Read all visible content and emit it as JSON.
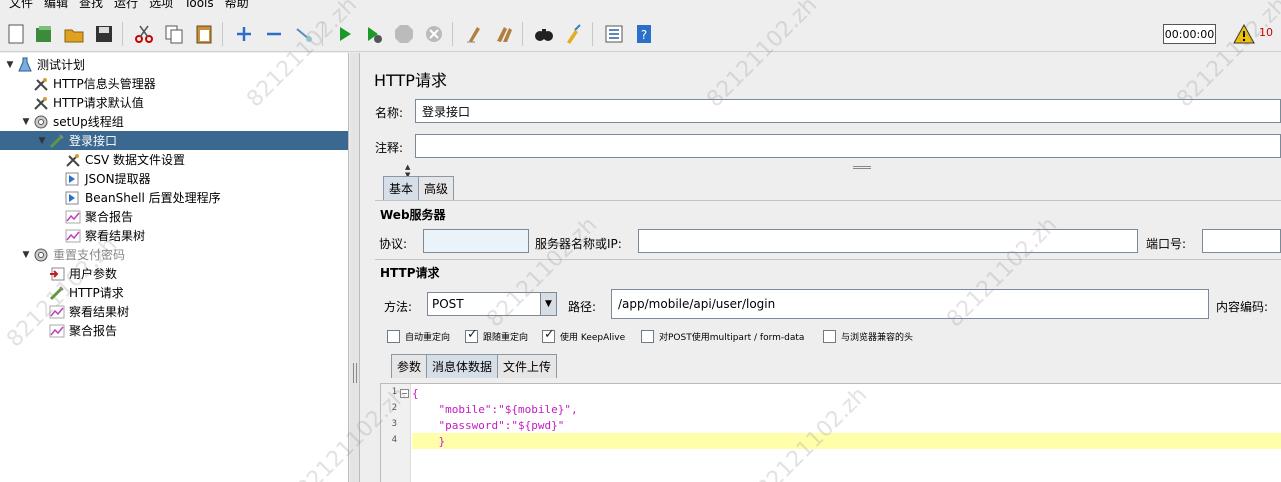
{
  "menu": [
    "文件",
    "编辑",
    "查找",
    "运行",
    "选项",
    "Tools",
    "帮助"
  ],
  "toolbar": {
    "timer": "00:00:00",
    "warning_count": "10",
    "icons": [
      "new-icon",
      "templates-icon",
      "open-icon",
      "save-icon",
      "cut-icon",
      "copy-icon",
      "paste-icon",
      "expand-icon",
      "collapse-icon",
      "toggle-icon",
      "start-icon",
      "start-no-pause-icon",
      "stop-icon",
      "shutdown-icon",
      "clear-icon",
      "clear-all-icon",
      "search-icon",
      "reset-search-icon",
      "function-helper-icon",
      "help-icon"
    ]
  },
  "tree": {
    "items": [
      {
        "label": "测试计划",
        "icon": "test-plan-icon",
        "level": 0,
        "expander": "▼"
      },
      {
        "label": "HTTP信息头管理器",
        "icon": "config-icon",
        "level": 1,
        "expander": ""
      },
      {
        "label": "HTTP请求默认值",
        "icon": "config-icon",
        "level": 1,
        "expander": ""
      },
      {
        "label": "setUp线程组",
        "icon": "thread-group-icon",
        "level": 1,
        "expander": "▼"
      },
      {
        "label": "登录接口",
        "icon": "sampler-icon",
        "level": 2,
        "expander": "▼",
        "selected": true
      },
      {
        "label": "CSV 数据文件设置",
        "icon": "config-icon",
        "level": 3,
        "expander": ""
      },
      {
        "label": "JSON提取器",
        "icon": "post-processor-icon",
        "level": 3,
        "expander": ""
      },
      {
        "label": "BeanShell 后置处理程序",
        "icon": "post-processor-icon",
        "level": 3,
        "expander": ""
      },
      {
        "label": "聚合报告",
        "icon": "listener-icon",
        "level": 3,
        "expander": ""
      },
      {
        "label": "察看结果树",
        "icon": "listener-icon",
        "level": 3,
        "expander": ""
      },
      {
        "label": "重置支付密码",
        "icon": "thread-group-icon",
        "level": 1,
        "expander": "▼",
        "disabled": true
      },
      {
        "label": "用户参数",
        "icon": "pre-processor-icon",
        "level": 2,
        "expander": ""
      },
      {
        "label": "HTTP请求",
        "icon": "sampler-icon",
        "level": 2,
        "expander": ""
      },
      {
        "label": "察看结果树",
        "icon": "listener-icon",
        "level": 2,
        "expander": ""
      },
      {
        "label": "聚合报告",
        "icon": "listener-icon",
        "level": 2,
        "expander": ""
      }
    ]
  },
  "panel": {
    "title": "HTTP请求",
    "name_label": "名称:",
    "name_value": "登录接口",
    "comment_label": "注释:",
    "comment_value": "",
    "tabs": [
      "基本",
      "高级"
    ],
    "web_server": {
      "title": "Web服务器",
      "protocol_label": "协议:",
      "protocol_value": "",
      "server_label": "服务器名称或IP:",
      "server_value": "",
      "port_label": "端口号:",
      "port_value": ""
    },
    "http_request": {
      "title": "HTTP请求",
      "method_label": "方法:",
      "method_value": "POST",
      "path_label": "路径:",
      "path_value": "/app/mobile/api/user/login",
      "encoding_label": "内容编码:"
    },
    "checkboxes": [
      {
        "label": "自动重定向",
        "checked": false
      },
      {
        "label": "跟随重定向",
        "checked": true
      },
      {
        "label": "使用 KeepAlive",
        "checked": true
      },
      {
        "label": "对POST使用multipart / form-data",
        "checked": false
      },
      {
        "label": "与浏览器兼容的头",
        "checked": false
      }
    ],
    "body_tabs": [
      "参数",
      "消息体数据",
      "文件上传"
    ],
    "editor": {
      "line_numbers": [
        "1",
        "2",
        "3",
        "4"
      ],
      "lines": [
        "{",
        "    \"mobile\":\"${mobile}\",",
        "    \"password\":\"${pwd}\"",
        "    }"
      ]
    }
  },
  "watermark": "82121102.zh"
}
